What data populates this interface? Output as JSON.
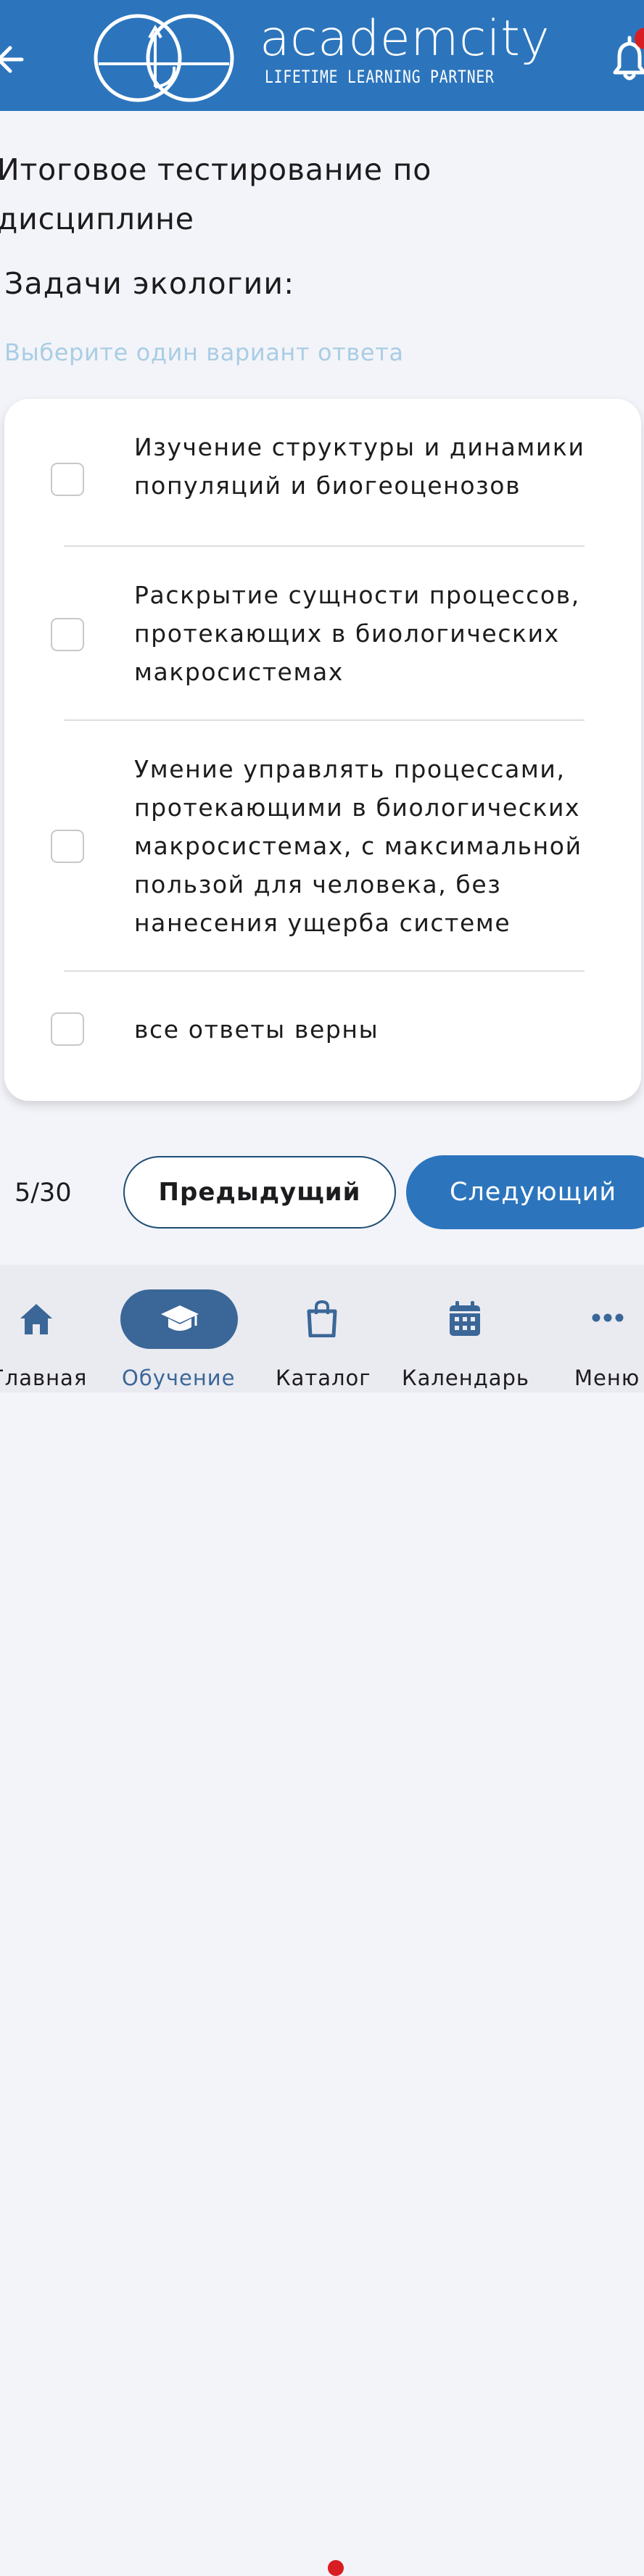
{
  "header": {
    "brand_name": "academcity",
    "brand_tagline": "LIFETIME LEARNING PARTNER",
    "back_icon": "arrow-left-icon",
    "notification_icon": "bell-icon",
    "notification_badge": true,
    "background_color": "#2c75bd"
  },
  "test": {
    "title": "Итоговое тестирование по дисциплине",
    "question": "Задачи экологии:",
    "hint": "Выберите один вариант ответа",
    "options": [
      {
        "label": "Изучение структуры и динамики популяций и биогеоценозов",
        "checked": false
      },
      {
        "label": "Раскрытие сущности процессов, протекающих в биологических макросистемах",
        "checked": false
      },
      {
        "label": "Умение управлять процессами, протекающими в биологических макросистемах, с максимальной пользой для человека, без нанесения ущерба системе",
        "checked": false
      },
      {
        "label": "все ответы верны",
        "checked": false
      }
    ]
  },
  "pagination": {
    "counter": "5/30",
    "prev_label": "Предыдущий",
    "next_label": "Следующий"
  },
  "bottom_nav": {
    "items": [
      {
        "label": "Главная",
        "icon": "home-icon",
        "active": false
      },
      {
        "label": "Обучение",
        "icon": "graduation-cap-icon",
        "active": true
      },
      {
        "label": "Каталог",
        "icon": "shopping-bag-icon",
        "active": false,
        "badge": true
      },
      {
        "label": "Календарь",
        "icon": "calendar-icon",
        "active": false
      },
      {
        "label": "Меню",
        "icon": "more-icon",
        "active": false
      }
    ]
  },
  "colors": {
    "accent": "#2c75bd",
    "active_nav": "#3a6797",
    "hint": "#a9cde4",
    "badge": "#d81e23"
  }
}
